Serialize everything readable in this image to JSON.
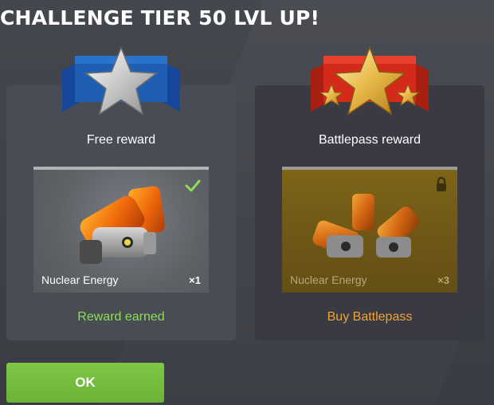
{
  "dialog": {
    "title": "CHALLENGE TIER 50 LVL UP!"
  },
  "free_reward": {
    "label": "Free reward",
    "badge_icon": "silver-star-badge-icon",
    "item_name": "Nuclear Energy",
    "item_count": "×1",
    "status_text": "Reward earned",
    "state_icon": "checkmark-icon",
    "status_color": "#8fdc5c"
  },
  "battlepass_reward": {
    "label": "Battlepass reward",
    "badge_icon": "gold-three-star-badge-icon",
    "item_name": "Nuclear Energy",
    "item_count": "×3",
    "status_text": "Buy Battlepass",
    "state_icon": "lock-icon",
    "status_color": "#f0a33a"
  },
  "actions": {
    "ok_label": "OK"
  },
  "colors": {
    "ok_button": "#74bc3e",
    "free_badge": "#1f5fb3",
    "battlepass_badge": "#d42a1a"
  }
}
